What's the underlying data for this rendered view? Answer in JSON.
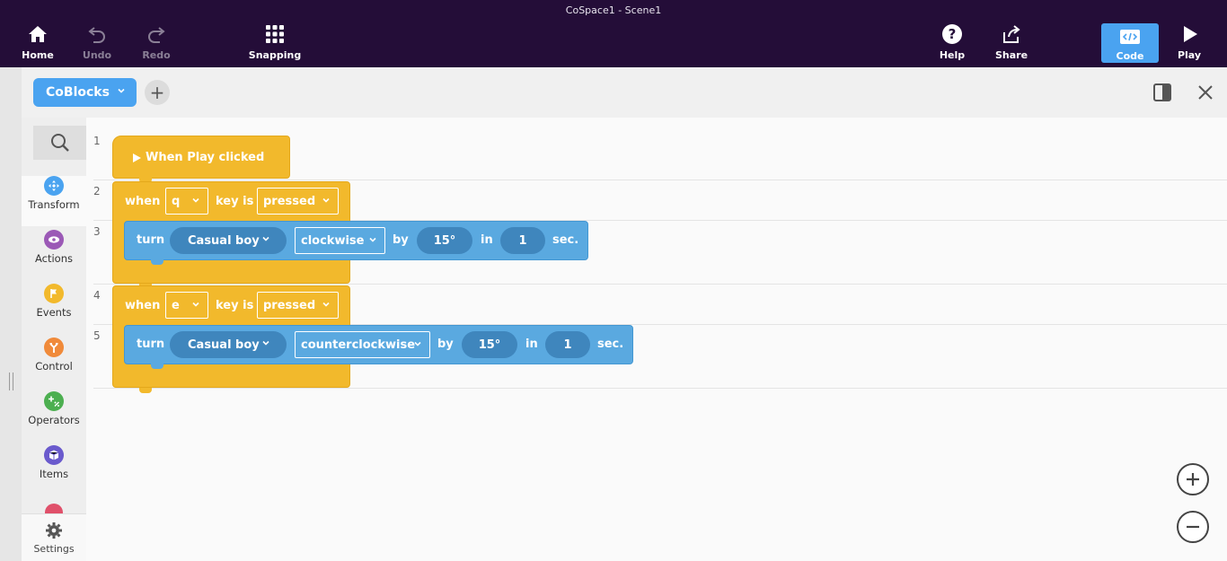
{
  "window": {
    "title": "CoSpace1 - Scene1"
  },
  "toolbar": {
    "home": "Home",
    "undo": "Undo",
    "redo": "Redo",
    "snapping": "Snapping",
    "help": "Help",
    "share": "Share",
    "code": "Code",
    "play": "Play"
  },
  "editor": {
    "tab_label": "CoBlocks",
    "add_tab": "+"
  },
  "palette": {
    "categories": [
      {
        "label": "Transform",
        "color": "#4aa3f0"
      },
      {
        "label": "Actions",
        "color": "#9b59b6"
      },
      {
        "label": "Events",
        "color": "#f2b92c"
      },
      {
        "label": "Control",
        "color": "#f08a3a"
      },
      {
        "label": "Operators",
        "color": "#4caf50"
      },
      {
        "label": "Items",
        "color": "#6a5acd"
      }
    ],
    "settings": "Settings"
  },
  "lines": [
    "1",
    "2",
    "3",
    "4",
    "5"
  ],
  "blocks": {
    "start": {
      "label": "When Play clicked"
    },
    "event1": {
      "when": "when",
      "key": "q",
      "key_is": "key is",
      "state": "pressed"
    },
    "turn1": {
      "turn": "turn",
      "item": "Casual boy",
      "direction": "clockwise",
      "by": "by",
      "angle": "15°",
      "in": "in",
      "duration": "1",
      "unit": "sec."
    },
    "event2": {
      "when": "when",
      "key": "e",
      "key_is": "key is",
      "state": "pressed"
    },
    "turn2": {
      "turn": "turn",
      "item": "Casual boy",
      "direction": "counterclockwise",
      "by": "by",
      "angle": "15°",
      "in": "in",
      "duration": "1",
      "unit": "sec."
    }
  },
  "zoom": {
    "in": "+",
    "out": "−"
  }
}
